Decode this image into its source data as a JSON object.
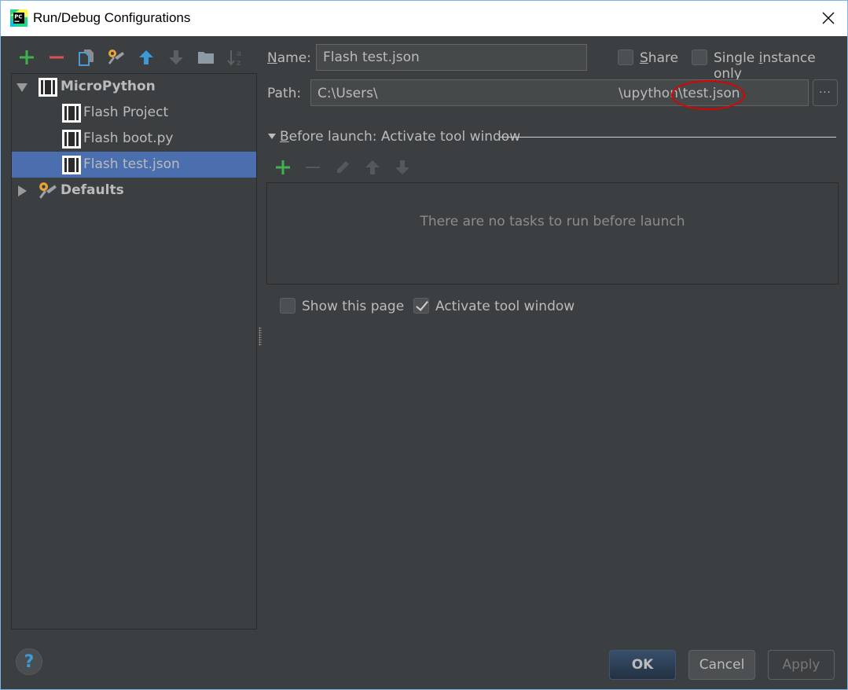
{
  "window": {
    "title": "Run/Debug Configurations",
    "app_icon": "pycharm-logo-icon",
    "close_icon": "close-icon"
  },
  "left_toolbar": [
    {
      "name": "add-configuration-button",
      "icon": "plus-icon",
      "color": "#3fb24f",
      "enabled": true
    },
    {
      "name": "remove-configuration-button",
      "icon": "minus-icon",
      "color": "#d9534f",
      "enabled": true
    },
    {
      "name": "copy-configuration-button",
      "icon": "copy-icon",
      "color": "#4a9bd0",
      "enabled": true
    },
    {
      "name": "edit-defaults-button",
      "icon": "wrench-icon",
      "color": "#e8a33a",
      "enabled": true
    },
    {
      "name": "move-up-button",
      "icon": "arrow-up-icon",
      "color": "#3d9ad6",
      "enabled": true
    },
    {
      "name": "move-down-button",
      "icon": "arrow-down-icon",
      "color": "#5e6163",
      "enabled": false
    },
    {
      "name": "create-folder-button",
      "icon": "folder-icon",
      "color": "#8c9aa6",
      "enabled": true
    },
    {
      "name": "sort-button",
      "icon": "sort-alpha-icon",
      "color": "#5e6163",
      "enabled": false
    }
  ],
  "tree": {
    "groups": [
      {
        "label": "MicroPython",
        "expanded": true,
        "children": [
          {
            "label": "Flash Project",
            "selected": false
          },
          {
            "label": "Flash boot.py",
            "selected": false
          },
          {
            "label": "Flash test.json",
            "selected": true
          }
        ]
      },
      {
        "label": "Defaults",
        "expanded": false,
        "children": []
      }
    ]
  },
  "form": {
    "name_label_mnemonic": "N",
    "name_label_rest": "ame:",
    "name_value": "Flash test.json",
    "share_label_mnemonic": "S",
    "share_label_rest": "hare",
    "share_checked": false,
    "single_instance_label_pre": "Single ",
    "single_instance_label_mnemonic": "i",
    "single_instance_label_rest": "nstance only",
    "single_instance_checked": false,
    "path_label": "Path:",
    "path_value_start": "C:\\Users\\",
    "path_value_end": "\\upython\\test.json",
    "browse_label": "···"
  },
  "before_launch": {
    "header_mnemonic": "B",
    "header_rest": "efore launch: Activate tool window",
    "toolbar": [
      {
        "name": "add-task-button",
        "icon": "plus-icon",
        "enabled": true
      },
      {
        "name": "remove-task-button",
        "icon": "minus-icon",
        "enabled": false
      },
      {
        "name": "edit-task-button",
        "icon": "pencil-icon",
        "enabled": false
      },
      {
        "name": "move-task-up-button",
        "icon": "arrow-up-icon",
        "enabled": false
      },
      {
        "name": "move-task-down-button",
        "icon": "arrow-down-icon",
        "enabled": false
      }
    ],
    "empty_text": "There are no tasks to run before launch",
    "show_this_page_label": "Show this page",
    "show_this_page_checked": false,
    "activate_tool_window_label": "Activate tool window",
    "activate_tool_window_checked": true
  },
  "footer": {
    "help_label": "?",
    "ok_label": "OK",
    "cancel_label": "Cancel",
    "apply_label": "Apply",
    "apply_enabled": false
  },
  "annotation": {
    "highlight_color": "#e00000",
    "highlighted_text": "test.json"
  }
}
